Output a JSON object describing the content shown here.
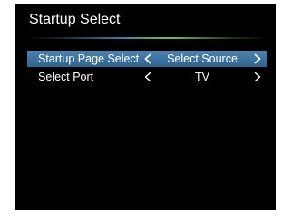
{
  "menu": {
    "title": "Startup Select",
    "items": [
      {
        "label": "Startup Page Select",
        "value": "Select Source",
        "selected": true,
        "left_icon": "chevron-left-icon",
        "right_icon": "chevron-right-icon"
      },
      {
        "label": "Select Port",
        "value": "TV",
        "selected": false,
        "left_icon": "chevron-left-icon",
        "right_icon": "chevron-right-icon"
      }
    ]
  },
  "colors": {
    "background": "#000000",
    "highlight": "#3d72a0",
    "text": "#ffffff",
    "rule_blue": "#3f7fb0",
    "rule_green": "#6ec25a"
  }
}
